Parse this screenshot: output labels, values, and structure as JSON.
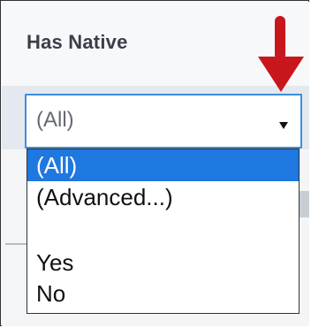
{
  "filter": {
    "title": "Has Native",
    "selected_value": "(All)",
    "options": [
      {
        "label": "(All)",
        "selected": true
      },
      {
        "label": "(Advanced...)",
        "selected": false
      },
      {
        "label": "",
        "selected": false
      },
      {
        "label": "Yes",
        "selected": false
      },
      {
        "label": "No",
        "selected": false
      }
    ]
  },
  "colors": {
    "accent": "#1e78e0",
    "focus_border": "#3b8ede",
    "annotation_arrow": "#c8161d"
  },
  "icons": {
    "dropdown": "caret-down-icon",
    "annotation": "red-down-arrow-icon"
  }
}
